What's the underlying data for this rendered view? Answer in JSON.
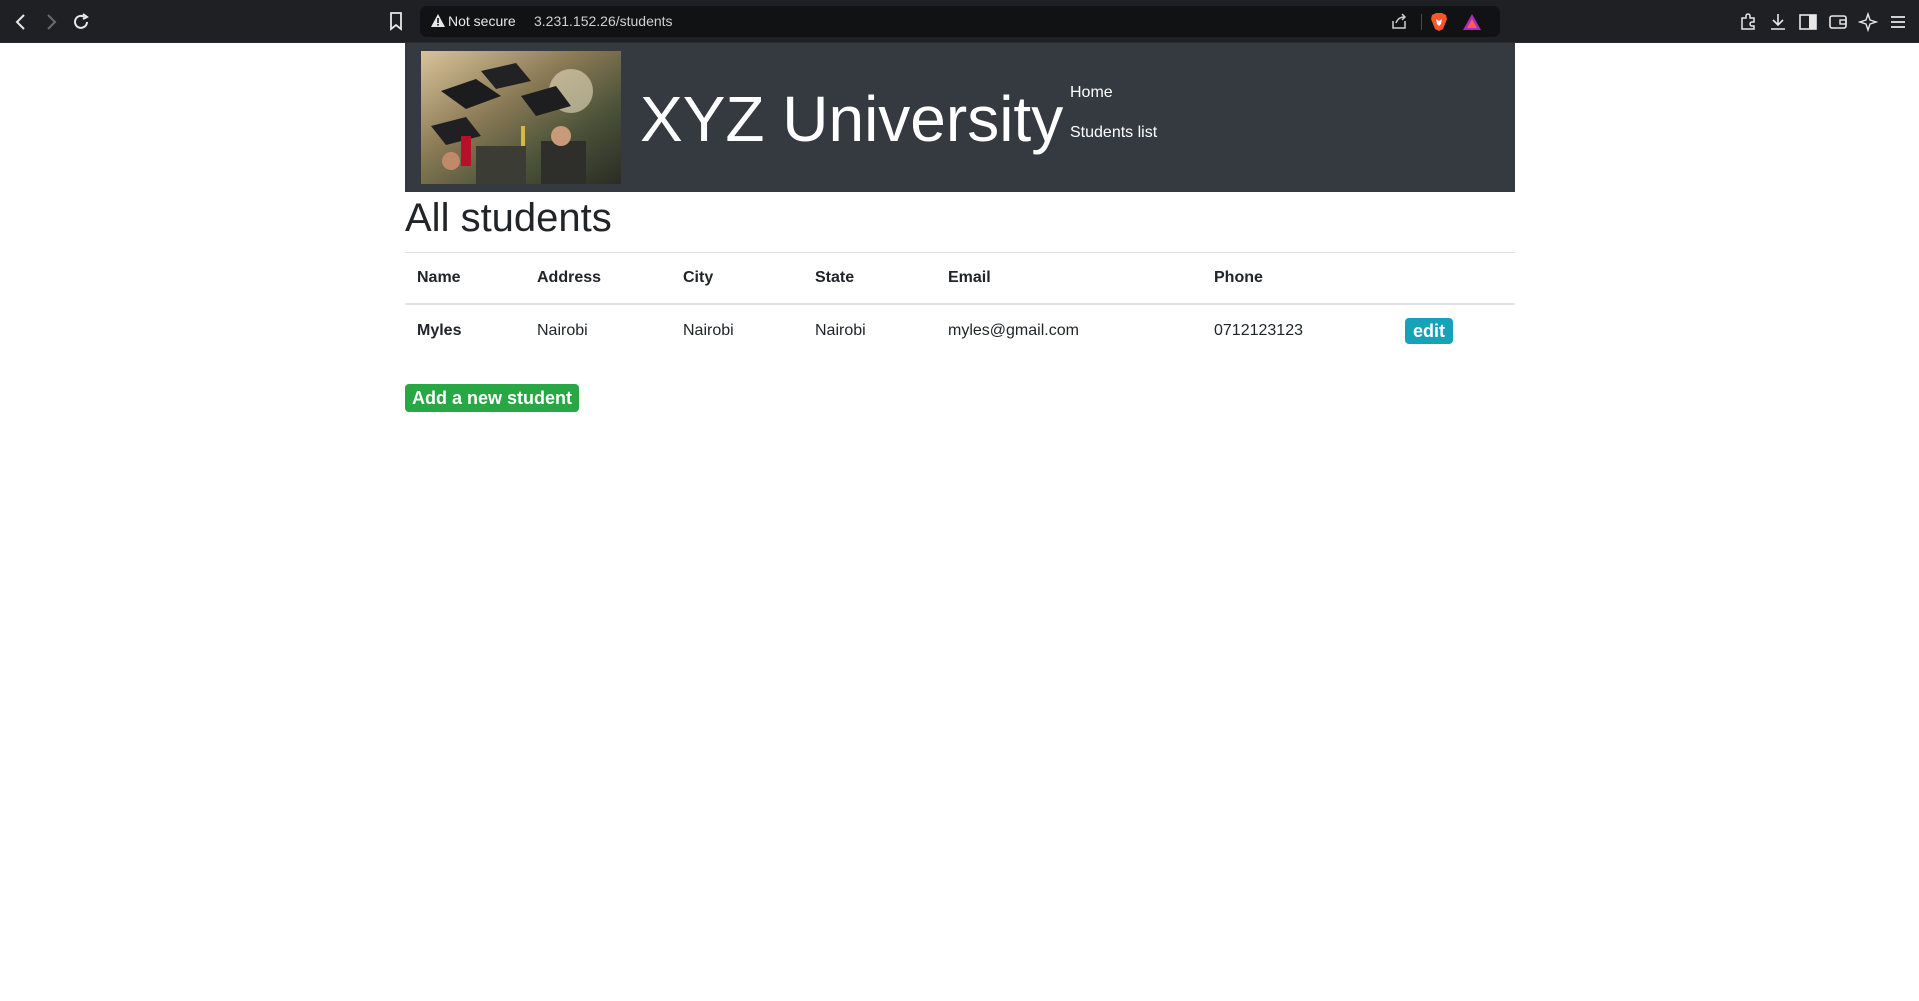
{
  "browser": {
    "security_label": "Not secure",
    "url": "3.231.152.26/students"
  },
  "header": {
    "brand": "XYZ University",
    "nav": [
      "Home",
      "Students list"
    ]
  },
  "main": {
    "title": "All students",
    "table": {
      "columns": [
        "Name",
        "Address",
        "City",
        "State",
        "Email",
        "Phone",
        ""
      ],
      "rows": [
        {
          "name": "Myles",
          "address": "Nairobi",
          "city": "Nairobi",
          "state": "Nairobi",
          "email": "myles@gmail.com",
          "phone": "0712123123",
          "action": "edit"
        }
      ]
    },
    "add_button": "Add a new student"
  },
  "colors": {
    "header_bg": "#343a40",
    "edit_button": "#17a2b8",
    "add_button": "#28a745"
  }
}
